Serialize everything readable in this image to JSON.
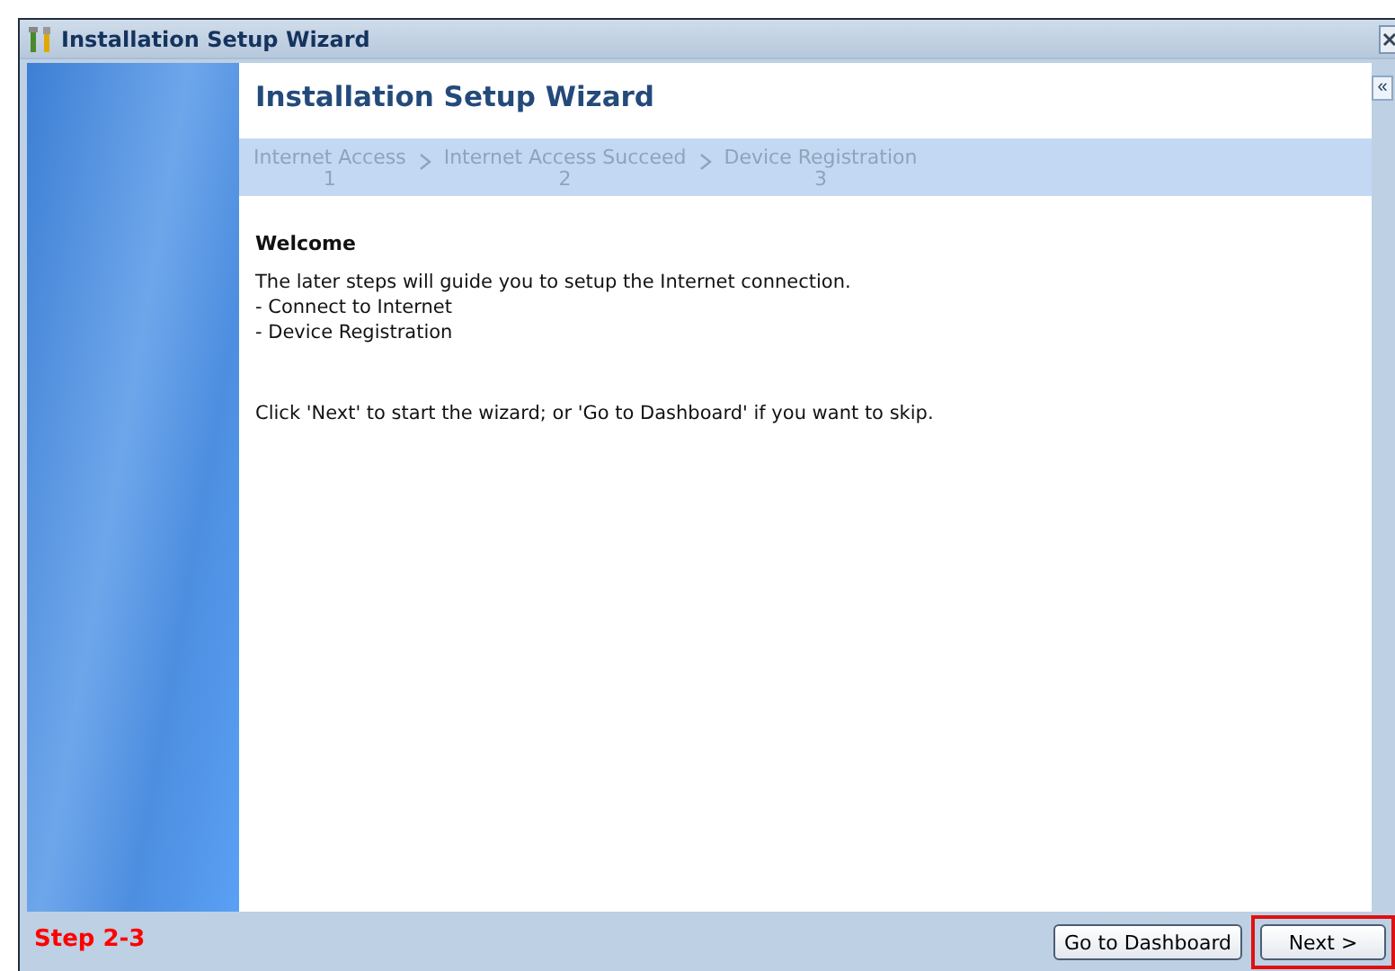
{
  "window": {
    "title": "Installation Setup Wizard"
  },
  "heading": "Installation Setup Wizard",
  "steps": [
    {
      "label": "Internet Access",
      "number": "1"
    },
    {
      "label": "Internet Access Succeed",
      "number": "2"
    },
    {
      "label": "Device Registration",
      "number": "3"
    }
  ],
  "collapse_button": "«",
  "welcome": {
    "title": "Welcome",
    "lines": [
      "The later steps will guide you to setup the Internet connection.",
      "- Connect to Internet",
      "- Device Registration"
    ],
    "hint": "Click 'Next' to start the wizard; or 'Go to Dashboard' if you want to skip."
  },
  "step_label": "Step 2-3",
  "buttons": [
    {
      "label": "Go to Dashboard",
      "highlighted": false
    },
    {
      "label": "Next >",
      "highlighted": true
    }
  ]
}
